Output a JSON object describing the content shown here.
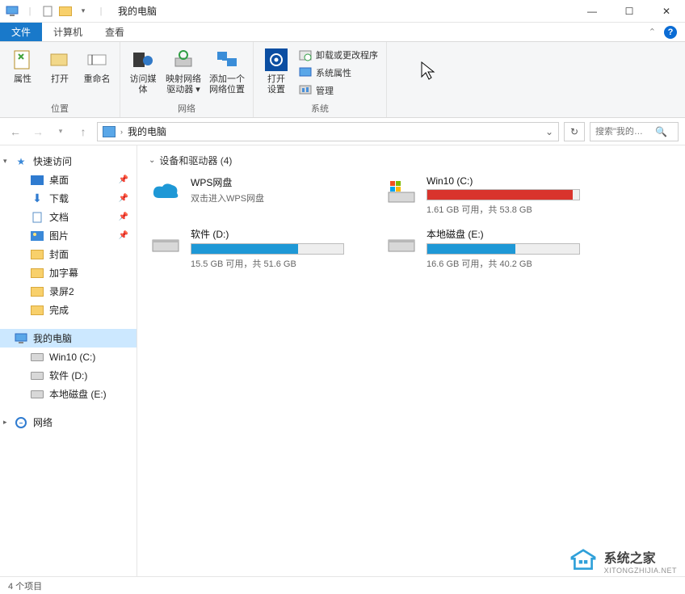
{
  "window": {
    "title": "我的电脑"
  },
  "tabs": {
    "file": "文件",
    "computer": "计算机",
    "view": "查看"
  },
  "ribbon": {
    "g1": {
      "label": "位置",
      "properties": "属性",
      "open": "打开",
      "rename": "重命名"
    },
    "g2": {
      "label": "网络",
      "media": "访问媒体",
      "map": "映射网络\n驱动器 ▾",
      "addloc": "添加一个\n网络位置"
    },
    "g3": {
      "label": "系统",
      "opensettings": "打开\n设置",
      "uninstall": "卸载或更改程序",
      "sysprops": "系统属性",
      "manage": "管理"
    }
  },
  "nav": {
    "crumb": "我的电脑",
    "search_placeholder": "搜索\"我的…"
  },
  "sidebar": {
    "quick": "快速访问",
    "desktop": "桌面",
    "downloads": "下载",
    "documents": "文档",
    "pictures": "图片",
    "cover": "封面",
    "subtitle": "加字幕",
    "rec": "录屏2",
    "done": "完成",
    "mypc": "我的电脑",
    "c": "Win10  (C:)",
    "d": "软件 (D:)",
    "e": "本地磁盘 (E:)",
    "network": "网络"
  },
  "content": {
    "section": "设备和驱动器 (4)",
    "wps": {
      "name": "WPS网盘",
      "sub": "双击进入WPS网盘"
    },
    "c": {
      "name": "Win10  (C:)",
      "stat": "1.61 GB 可用，共 53.8 GB",
      "fill_pct": 96,
      "color": "#d9332c"
    },
    "d": {
      "name": "软件 (D:)",
      "stat": "15.5 GB 可用，共 51.6 GB",
      "fill_pct": 70,
      "color": "#1e98d6"
    },
    "e": {
      "name": "本地磁盘 (E:)",
      "stat": "16.6 GB 可用，共 40.2 GB",
      "fill_pct": 58,
      "color": "#1e98d6"
    }
  },
  "status": {
    "text": "4 个项目"
  },
  "watermark": {
    "t1": "系统之家",
    "t2": "XITONGZHIJIA.NET"
  }
}
